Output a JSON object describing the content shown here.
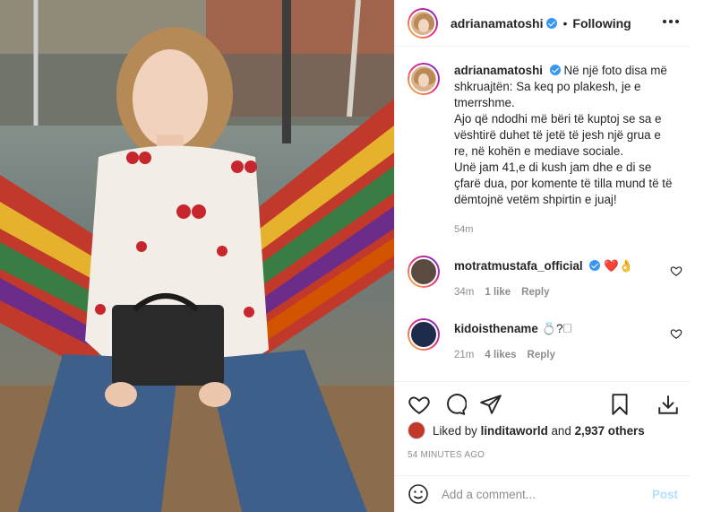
{
  "header": {
    "username": "adrianamatoshi",
    "separator": "•",
    "follow_status": "Following"
  },
  "caption": {
    "username": "adrianamatoshi",
    "text": "Në një foto disa më shkruajtën: Sa keq po plakesh, je e tmerrshme.\nAjo që ndodhi më bëri të kuptoj se sa e vështirë duhet të jetë të jesh një grua e re, në kohën e mediave sociale.\nUnë jam 41,e di kush jam dhe e di se çfarë dua, por komente të tilla mund të të dëmtojnë vetëm shpirtin e juaj!",
    "time": "54m"
  },
  "comments": [
    {
      "username": "motratmustafa_official",
      "verified": true,
      "text": "❤️👌",
      "time": "34m",
      "likes": "1 like",
      "reply_label": "Reply"
    },
    {
      "username": "kidoisthename",
      "verified": false,
      "text": "💍?🗆",
      "time": "21m",
      "likes": "4 likes",
      "reply_label": "Reply"
    }
  ],
  "likes": {
    "prefix": "Liked by",
    "user": "linditaworld",
    "conjunction": "and",
    "others": "2,937 others"
  },
  "post_time": "54 MINUTES AGO",
  "add_comment": {
    "placeholder": "Add a comment...",
    "post_label": "Post"
  },
  "icons": [
    "more-icon",
    "verified-icon",
    "heart-icon",
    "comment-icon",
    "share-icon",
    "bookmark-icon",
    "emoji-icon"
  ],
  "colors": {
    "verified": "#3897f0",
    "post_disabled": "#b2dffc",
    "meta_gray": "#8e8e8e"
  }
}
